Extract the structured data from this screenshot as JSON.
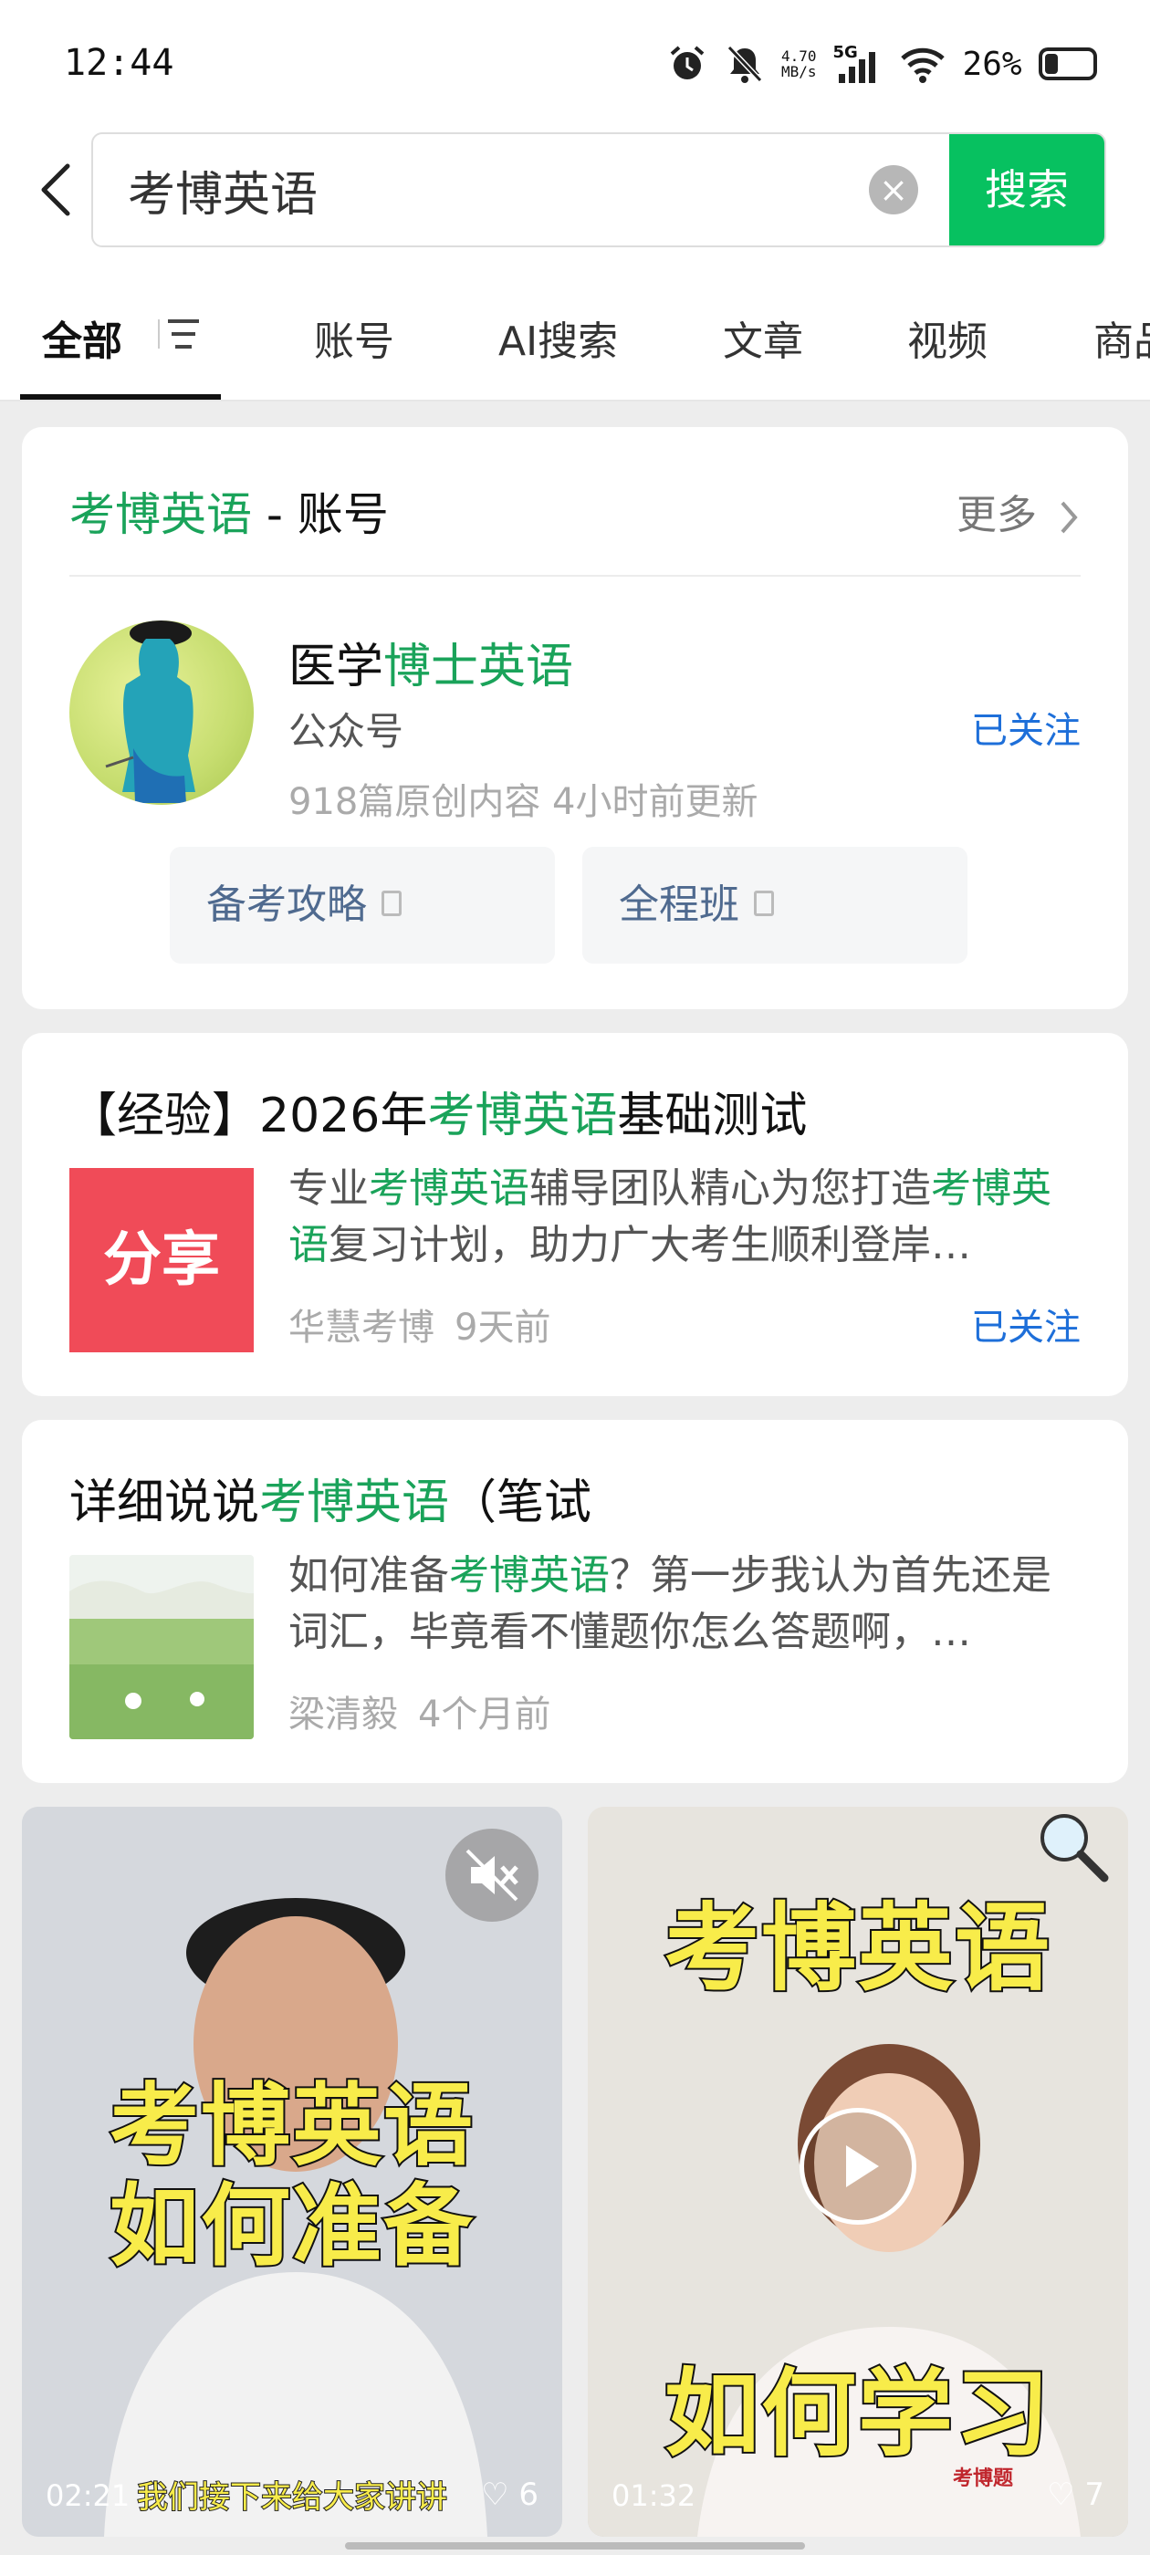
{
  "status_bar": {
    "time": "12:44",
    "net_speed_value": "4.70",
    "net_speed_unit": "MB/s",
    "network": "5G",
    "battery": "26%"
  },
  "search": {
    "query": "考博英语",
    "button_label": "搜索"
  },
  "tabs": [
    {
      "label": "全部"
    },
    {
      "label": "账号"
    },
    {
      "label": "AI搜索"
    },
    {
      "label": "文章"
    },
    {
      "label": "视频"
    },
    {
      "label": "商品"
    }
  ],
  "account_card": {
    "title_highlight": "考博英语",
    "title_suffix": " - 账号",
    "more_label": "更多",
    "name_prefix": "医学",
    "name_highlight": "博士英语",
    "type": "公众号",
    "follow_status": "已关注",
    "meta": "918篇原创内容  4小时前更新",
    "buttons": [
      {
        "label": "备考攻略"
      },
      {
        "label": "全程班"
      }
    ]
  },
  "article1": {
    "title_prefix": "【经验】2026年",
    "title_highlight": "考博英语",
    "title_suffix": "基础测试",
    "thumb_label": "分享",
    "body_1": "专业",
    "body_hl_1": "考博英语",
    "body_2": "辅导团队精心为您打造",
    "body_hl_2": "考博英语",
    "body_3": "复习计划，助力广大考生顺利登岸…",
    "author": "华慧考博",
    "time": "9天前",
    "follow_status": "已关注"
  },
  "article2": {
    "title_prefix": "详细说说",
    "title_highlight": "考博英语",
    "title_suffix": "（笔试",
    "body_1": "如何准备",
    "body_hl_1": "考博英语",
    "body_2": "？第一步我认为首先还是词汇，毕竟看不懂题你怎么答题啊，…",
    "author": "梁清毅",
    "time": "4个月前"
  },
  "videos": [
    {
      "caption_line1": "考博英语",
      "caption_line2": "如何准备",
      "subtitle": "我们接下来给大家讲讲",
      "duration": "02:21",
      "likes": "♡ 6"
    },
    {
      "caption_line1": "考博英语",
      "caption_line2": "如何学习",
      "badge": "考博题",
      "duration": "01:32",
      "likes": "♡ 7"
    }
  ],
  "colors": {
    "highlight": "#1aa35a",
    "search_button": "#07c160",
    "follow_link": "#1e6fd9",
    "share_thumb": "#f04b58",
    "video_caption": "#f8ec4a"
  }
}
